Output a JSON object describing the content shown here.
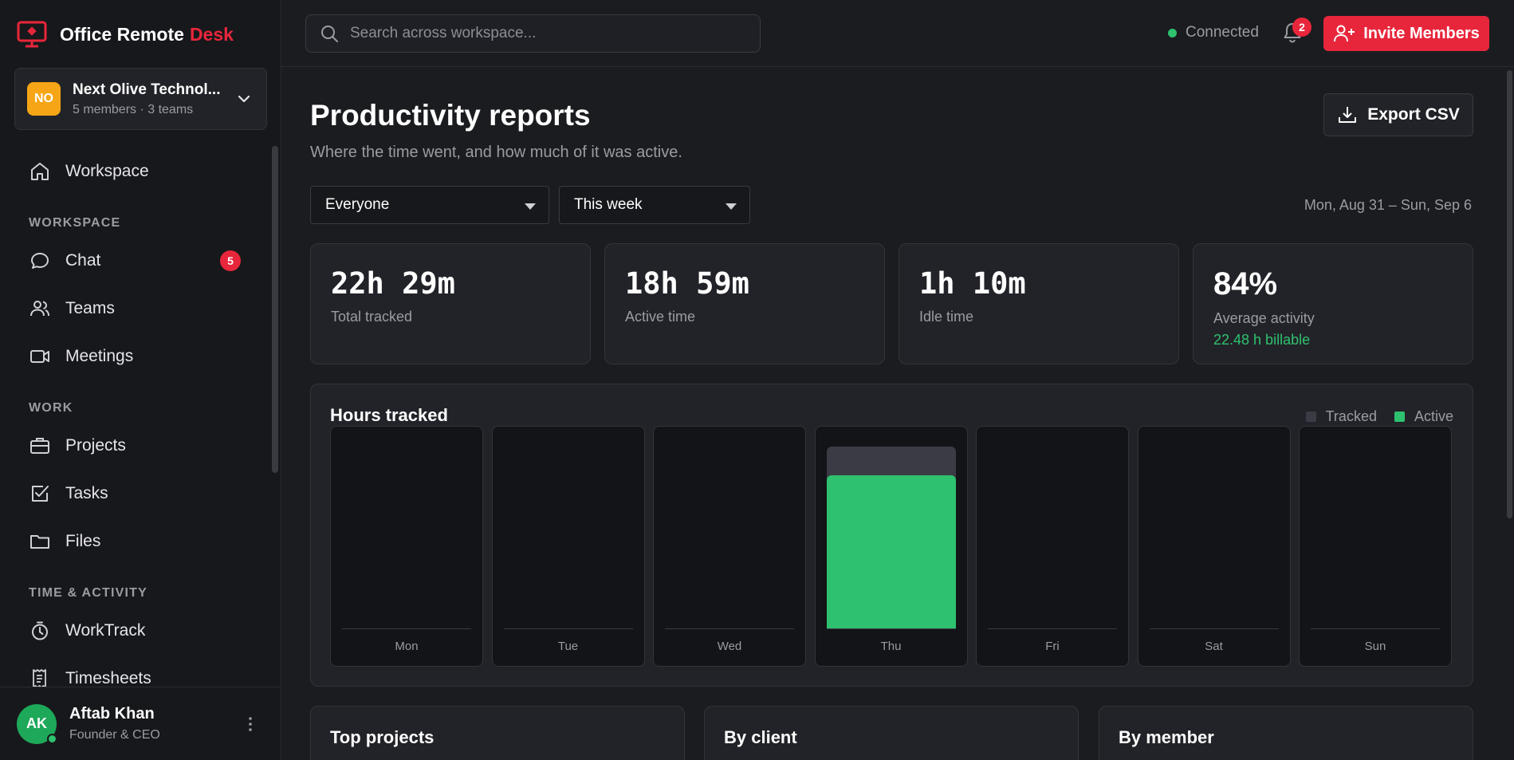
{
  "brand": {
    "name": "Office Remote",
    "accent": "Desk",
    "accent_color": "#e8263b"
  },
  "org": {
    "initials": "NO",
    "name": "Next Olive Technol...",
    "meta": "5 members · 3 teams",
    "color": "#f5a516"
  },
  "nav": {
    "workspace_home": "Workspace",
    "section_workspace": "WORKSPACE",
    "chat": "Chat",
    "chat_badge": "5",
    "teams": "Teams",
    "meetings": "Meetings",
    "section_work": "WORK",
    "projects": "Projects",
    "tasks": "Tasks",
    "files": "Files",
    "section_time": "TIME & ACTIVITY",
    "worktrack": "WorkTrack",
    "timesheets": "Timesheets"
  },
  "user": {
    "initials": "AK",
    "name": "Aftab Khan",
    "role": "Founder & CEO"
  },
  "topbar": {
    "search_placeholder": "Search across workspace...",
    "connection": "Connected",
    "notifications": "2",
    "invite_label": "Invite Members"
  },
  "page": {
    "title": "Productivity reports",
    "subtitle": "Where the time went, and how much of it was active.",
    "export_label": "Export CSV",
    "filter_member": "Everyone",
    "filter_period": "This week",
    "date_range": "Mon, Aug 31 – Sun, Sep 6"
  },
  "stats": [
    {
      "value": "22h 29m",
      "label": "Total tracked"
    },
    {
      "value": "18h 59m",
      "label": "Active time"
    },
    {
      "value": "1h 10m",
      "label": "Idle time"
    },
    {
      "value": "84%",
      "label": "Average activity",
      "extra": "22.48 h billable"
    }
  ],
  "chart_data": {
    "type": "bar",
    "title": "Hours tracked",
    "categories": [
      "Mon",
      "Tue",
      "Wed",
      "Thu",
      "Fri",
      "Sat",
      "Sun"
    ],
    "series": [
      {
        "name": "Tracked",
        "color": "#3a3b44",
        "values": [
          0,
          0,
          0,
          22.48,
          0,
          0,
          0
        ]
      },
      {
        "name": "Active",
        "color": "#2ec16f",
        "values": [
          0,
          0,
          0,
          18.98,
          0,
          0,
          0
        ]
      }
    ],
    "ylim": [
      0,
      23.5
    ]
  },
  "bottom_cards": [
    "Top projects",
    "By client",
    "By member"
  ]
}
